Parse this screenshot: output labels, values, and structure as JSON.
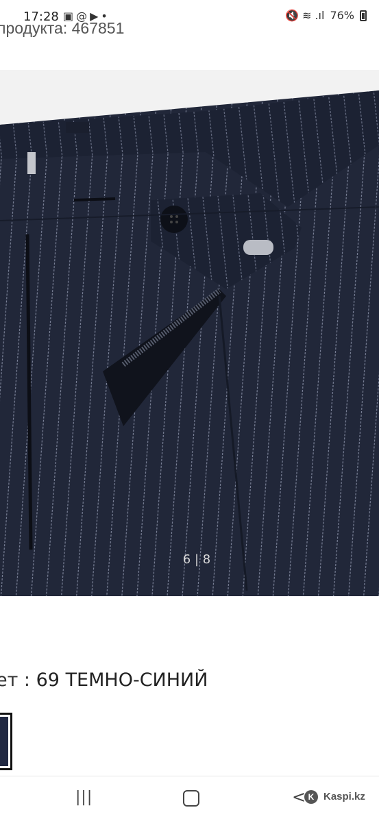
{
  "status_bar": {
    "time": "17:28",
    "left_icons": [
      "image-icon",
      "at-icon",
      "youtube-icon",
      "dot-icon"
    ],
    "left_glyphs": "▣@▶•",
    "right_icons": [
      "mute-icon",
      "wifi-icon",
      "signal-icon",
      "battery-icon"
    ],
    "right_glyphs": "🔇 ≋ .ıl",
    "battery": "76%"
  },
  "product": {
    "code_text": "продукта: 467851"
  },
  "gallery": {
    "page_indicator": "6 | 8",
    "fabric_color": "#1f2538"
  },
  "color_selector": {
    "label": "ет :",
    "value": "69 ТЕМНО-СИНИЙ",
    "swatch_color": "#202842"
  },
  "nav": {
    "recent_glyph": "|||",
    "back_glyph": "<",
    "brand_mark": "K",
    "brand": "Kaspi.kz"
  }
}
